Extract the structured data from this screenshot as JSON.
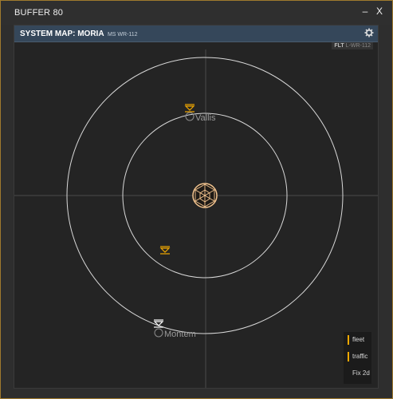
{
  "window": {
    "title": "BUFFER 80",
    "minimize_label": "–",
    "close_label": "X"
  },
  "panel": {
    "title": "SYSTEM MAP: MORIA",
    "subtitle": "MS WR-112",
    "flt_label": "FLT",
    "flt_value": "L-WR-112",
    "gear_icon": "gear-icon"
  },
  "map": {
    "locations": [
      {
        "name": "Vallis"
      },
      {
        "name": "Montem"
      }
    ],
    "markers": [
      {
        "type": "fleet",
        "color": "#f0a800"
      },
      {
        "type": "fleet",
        "color": "#f0a800"
      },
      {
        "type": "player",
        "color": "#ffffff"
      }
    ],
    "star_color": "#f3c48f"
  },
  "legend": {
    "items": [
      {
        "label": "fleet",
        "color": "#f0a800"
      },
      {
        "label": "traffic",
        "color": "#f0a800"
      },
      {
        "label": "Fix 2d",
        "color": ""
      }
    ]
  },
  "colors": {
    "accent": "#f0a800",
    "header": "#35475a",
    "border": "#a07a2e"
  }
}
